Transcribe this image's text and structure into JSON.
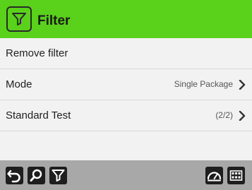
{
  "header": {
    "title": "Filter",
    "icon": "filter-icon",
    "color": "#5ad11b"
  },
  "rows": [
    {
      "label": "Remove filter",
      "value": "",
      "chevron": false
    },
    {
      "label": "Mode",
      "value": "Single Package",
      "chevron": true
    },
    {
      "label": "Standard Test",
      "value": "(2/2)",
      "chevron": true
    }
  ],
  "toolbar": {
    "left_buttons": [
      "back-icon",
      "search-icon",
      "filter-icon"
    ],
    "right_buttons": [
      "gauge-icon",
      "grid-menu-icon"
    ]
  }
}
